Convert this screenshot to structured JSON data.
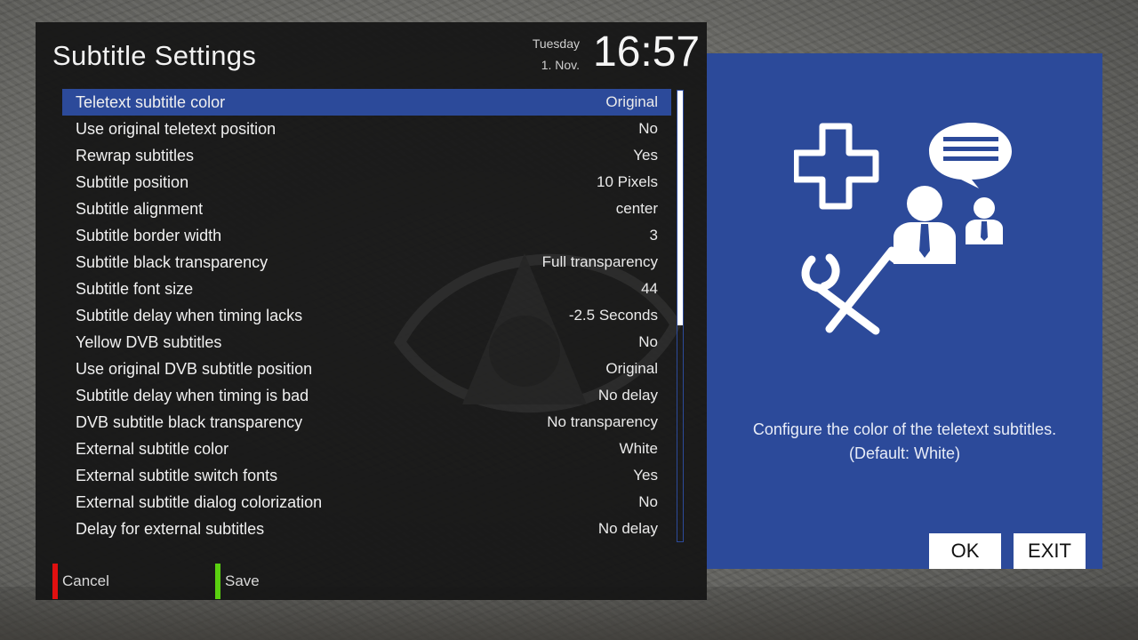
{
  "header": {
    "title": "Subtitle Settings",
    "day": "Tuesday",
    "date": "1. Nov.",
    "time": "16:57"
  },
  "settings": [
    {
      "label": "Teletext subtitle color",
      "value": "Original",
      "selected": true
    },
    {
      "label": "Use original teletext position",
      "value": "No"
    },
    {
      "label": "Rewrap subtitles",
      "value": "Yes"
    },
    {
      "label": "Subtitle position",
      "value": "10 Pixels"
    },
    {
      "label": "Subtitle alignment",
      "value": "center"
    },
    {
      "label": "Subtitle border width",
      "value": "3"
    },
    {
      "label": "Subtitle black transparency",
      "value": "Full transparency"
    },
    {
      "label": "Subtitle font size",
      "value": "44"
    },
    {
      "label": "Subtitle delay when timing lacks",
      "value": "-2.5 Seconds"
    },
    {
      "label": "Yellow DVB subtitles",
      "value": "No"
    },
    {
      "label": "Use original DVB subtitle position",
      "value": "Original"
    },
    {
      "label": "Subtitle delay when timing is bad",
      "value": "No delay"
    },
    {
      "label": "DVB subtitle black transparency",
      "value": "No transparency"
    },
    {
      "label": "External subtitle color",
      "value": "White"
    },
    {
      "label": "External subtitle switch fonts",
      "value": "Yes"
    },
    {
      "label": "External subtitle dialog colorization",
      "value": "No"
    },
    {
      "label": "Delay for external subtitles",
      "value": "No delay"
    }
  ],
  "scroll": {
    "visible_fraction": 0.52
  },
  "buttons": {
    "cancel_label": "Cancel",
    "save_label": "Save",
    "ok_label": "OK",
    "exit_label": "EXIT"
  },
  "info": {
    "description": "Configure the color of the teletext subtitles.",
    "default_note": "(Default: White)",
    "illustration": "settings-support-icon"
  },
  "colors": {
    "accent": "#2c4a9a",
    "cancel": "#e01010",
    "save": "#5ad010"
  }
}
